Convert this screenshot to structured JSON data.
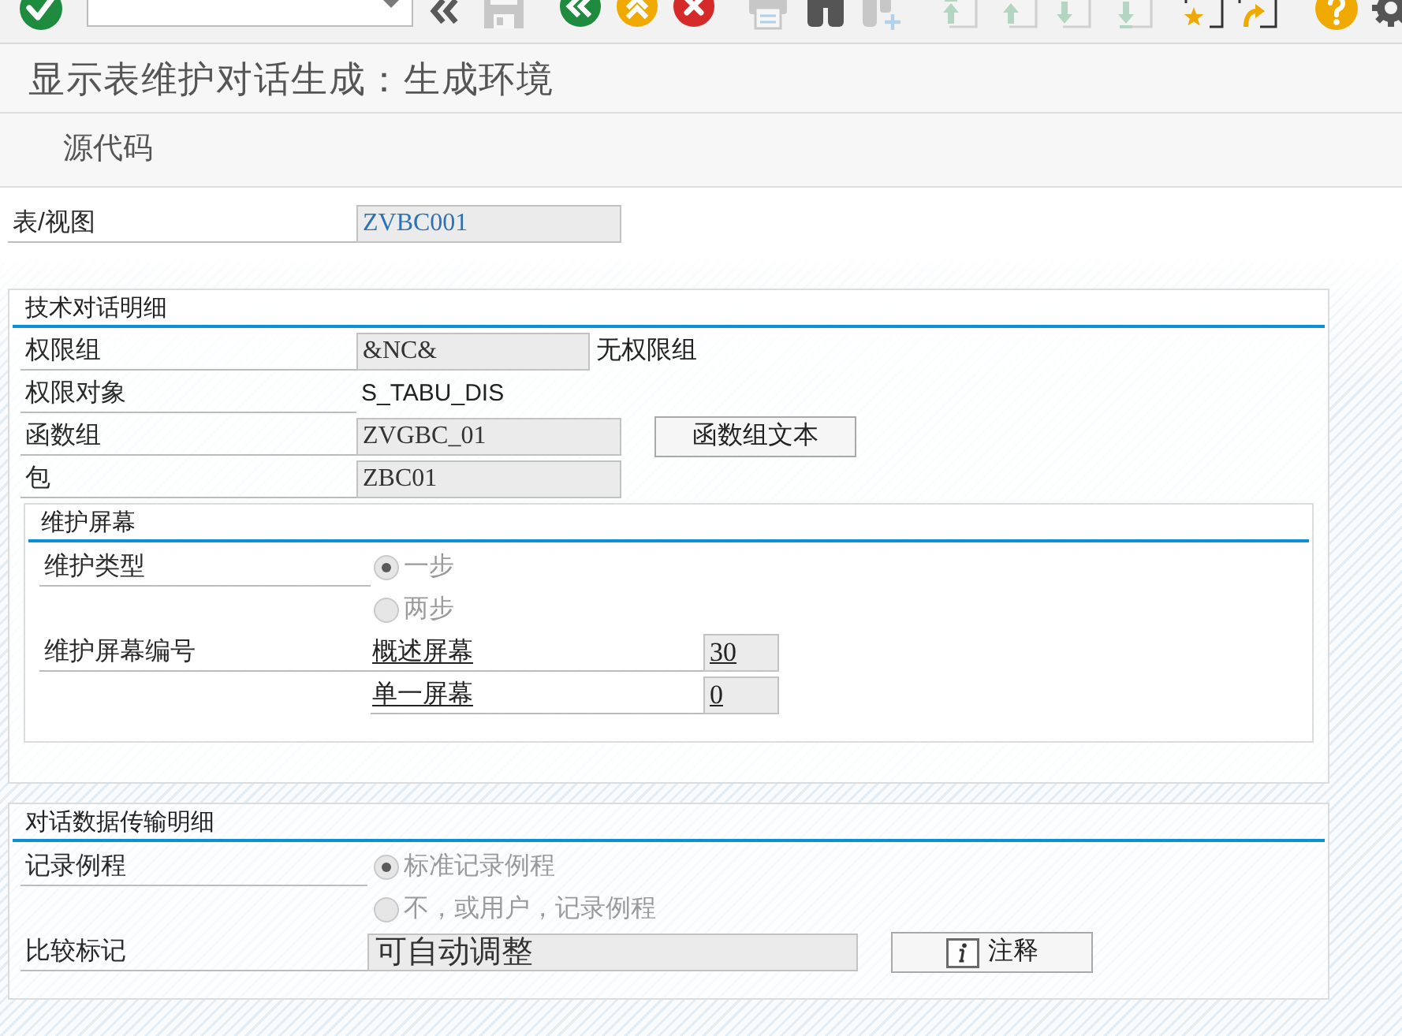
{
  "toolbar": {
    "items": [
      {
        "kind": "enter",
        "disabled": false
      },
      {
        "kind": "command_field"
      },
      {
        "kind": "collapse",
        "disabled": false
      },
      {
        "kind": "save",
        "disabled": true
      },
      {
        "kind": "back",
        "disabled": false
      },
      {
        "kind": "exit",
        "disabled": false
      },
      {
        "kind": "cancel",
        "disabled": false
      },
      {
        "kind": "print",
        "disabled": true
      },
      {
        "kind": "find",
        "disabled": false
      },
      {
        "kind": "find_next",
        "disabled": true
      },
      {
        "kind": "first_page",
        "disabled": true
      },
      {
        "kind": "previous_page",
        "disabled": true
      },
      {
        "kind": "next_page",
        "disabled": true
      },
      {
        "kind": "last_page",
        "disabled": true
      },
      {
        "kind": "new_session",
        "disabled": false
      },
      {
        "kind": "shortcut",
        "disabled": false
      },
      {
        "kind": "help",
        "disabled": false
      },
      {
        "kind": "settings",
        "disabled": false
      }
    ]
  },
  "title": "显示表维护对话生成：生成环境",
  "app_toolbar": {
    "buttons": [
      {
        "label": "源代码"
      }
    ]
  },
  "table_view": {
    "label": "表/视图",
    "value": "ZVBC001",
    "highlighted": true
  },
  "technical_dialog_details": {
    "title": "技术对话明细",
    "rows": [
      {
        "kind": "field",
        "label": "权限组",
        "value": "&NC&",
        "description": "无权限组"
      },
      {
        "kind": "text",
        "label": "权限对象",
        "value": "S_TABU_DIS"
      },
      {
        "kind": "field",
        "label": "函数组",
        "value": "ZVGBC_01",
        "button": "函数组文本"
      },
      {
        "kind": "field",
        "label": "包",
        "value": "ZBC01"
      }
    ],
    "maintenance_screen": {
      "title": "维护屏幕",
      "maintenance_type": {
        "label": "维护类型",
        "disabled": true,
        "options": [
          {
            "label": "一步",
            "selected": true
          },
          {
            "label": "两步",
            "selected": false
          }
        ]
      },
      "screen_numbers": {
        "label": "维护屏幕编号",
        "rows": [
          {
            "label": "概述屏幕",
            "value": "30"
          },
          {
            "label": "单一屏幕",
            "value": "0"
          }
        ]
      }
    }
  },
  "dialog_data_transport_details": {
    "title": "对话数据传输明细",
    "recording_routine": {
      "label": "记录例程",
      "disabled": true,
      "options": [
        {
          "label": "标准记录例程",
          "selected": true
        },
        {
          "label": "不，或用户，记录例程",
          "selected": false
        }
      ]
    },
    "compare_flag": {
      "label": "比较标记",
      "value": "可自动调整",
      "button": "注释"
    }
  }
}
